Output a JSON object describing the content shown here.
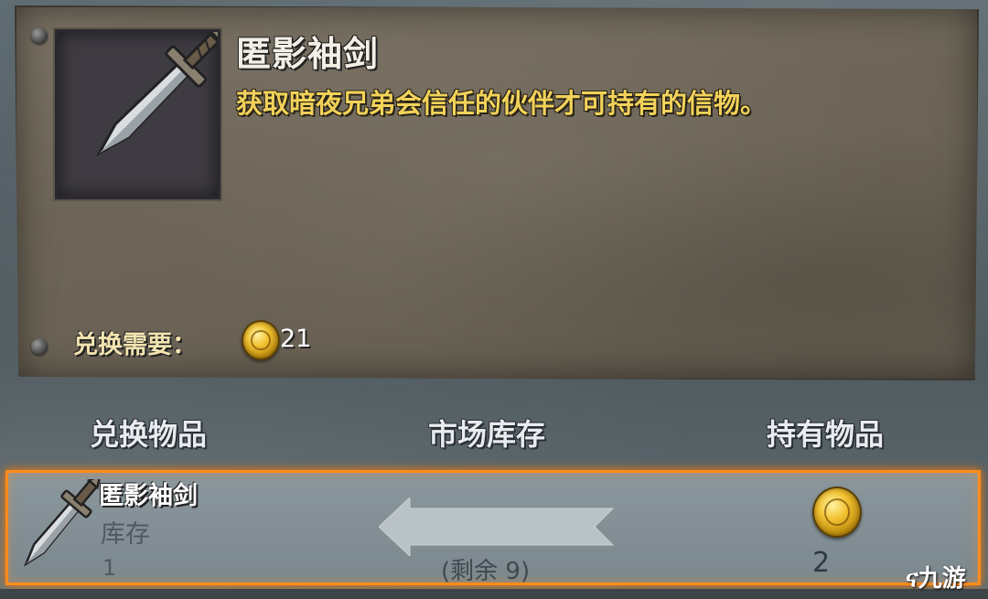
{
  "item": {
    "name": "匿影袖剑",
    "description": "获取暗夜兄弟会信任的伙伴才可持有的信物。",
    "icon": "dagger-icon"
  },
  "cost": {
    "label": "兑换需要：",
    "currency_icon": "gold-coin-icon",
    "amount": "21"
  },
  "columns": {
    "exchange_item": "兑换物品",
    "market_stock": "市场库存",
    "owned_items": "持有物品"
  },
  "selected_row": {
    "name": "匿影袖剑",
    "stock_label": "库存",
    "stock_value": "1",
    "remaining": "(剩余 9)",
    "owned_count": "2",
    "highlight_color": "#ff8c1a"
  },
  "watermark": "九游"
}
